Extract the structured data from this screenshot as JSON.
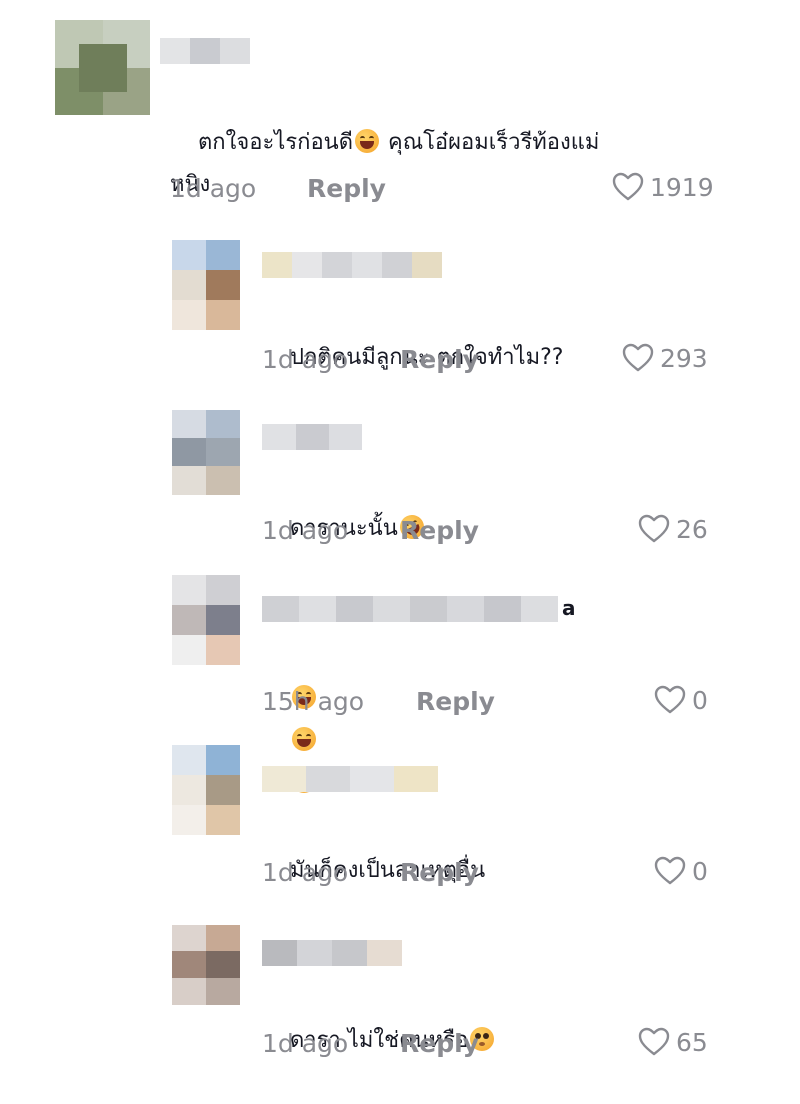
{
  "comments": [
    {
      "text": "ตกใจอะไรก่อนดี",
      "text_emoji": "sweat-smile-emoji",
      "text_after": " คุณโอ๋ผอมเร็วรีท้องแม่",
      "text_line2": "หนิง",
      "time": "1d ago",
      "reply": "Reply",
      "likes": "1919"
    },
    {
      "text": "ปกติคนมีลูกนะ ตกใจทำไม??",
      "time": "1d ago",
      "reply": "Reply",
      "likes": "293"
    },
    {
      "text": "ดารานะนั้น",
      "text_emoji": "rofl-emoji",
      "time": "1d ago",
      "reply": "Reply",
      "likes": "26"
    },
    {
      "name_suffix": "a",
      "text_emojis": "laughing-emoji x3",
      "time": "15h ago",
      "reply": "Reply",
      "likes": "0"
    },
    {
      "text": "มันก็คงเป็นสาเหตุอื่น",
      "time": "1d ago",
      "reply": "Reply",
      "likes": "0"
    },
    {
      "text": "ดารา ไม่ใช่คนหรือ",
      "text_emoji": "pleading-face-emoji",
      "time": "1d ago",
      "reply": "Reply",
      "likes": "65"
    }
  ],
  "icons": {
    "like": "heart-outline-icon"
  },
  "colors": {
    "meta_gray": "#8a8b91",
    "text": "#161823"
  }
}
